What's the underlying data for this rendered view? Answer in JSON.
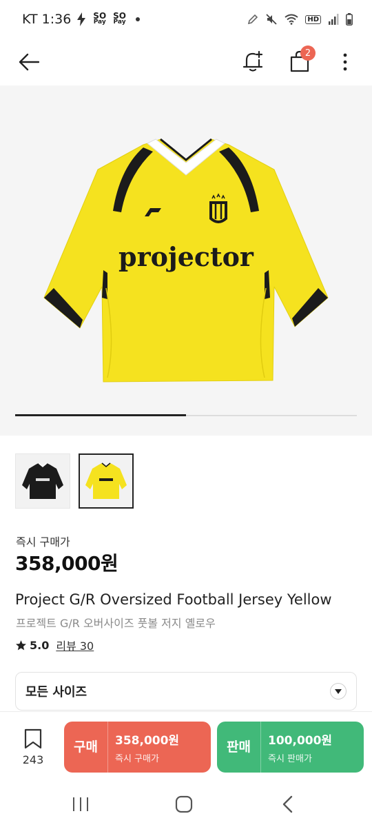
{
  "status_bar": {
    "carrier_time": "KT 1:36",
    "pay_top": "SO",
    "pay_bottom": "Pay",
    "network": "HD"
  },
  "app_bar": {
    "cart_count": "2"
  },
  "product": {
    "thumbnail_count": 2,
    "selected_thumbnail": 2,
    "image_progress": 0.5,
    "instant_label": "즉시 구매가",
    "price": "358,000원",
    "title_en": "Project G/R Oversized Football Jersey Yellow",
    "title_ko": "프로젝트 G/R 오버사이즈 풋볼 저지 옐로우",
    "rating": "5.0",
    "review_label": "리뷰 30",
    "jersey_wordmark": "projector"
  },
  "size_selector": {
    "label": "모든 사이즈"
  },
  "action_bar": {
    "bookmark_count": "243",
    "buy": {
      "kind": "구매",
      "price": "358,000원",
      "sub": "즉시 구매가",
      "color": "#ec6654"
    },
    "sell": {
      "kind": "판매",
      "price": "100,000원",
      "sub": "즉시 판매가",
      "color": "#41b979"
    }
  },
  "icons": [
    "back-arrow-icon",
    "bell-add-icon",
    "shopping-bag-icon",
    "more-vertical-icon",
    "star-icon",
    "chevron-down-icon",
    "bookmark-icon",
    "recent-apps-icon",
    "home-icon",
    "nav-back-icon"
  ]
}
